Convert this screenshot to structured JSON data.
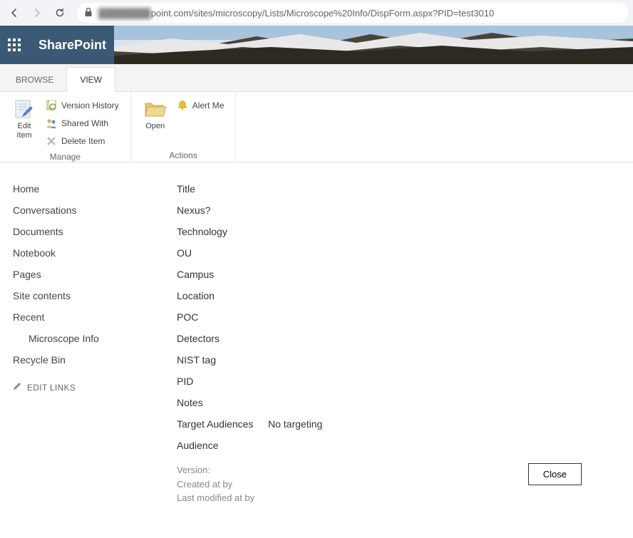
{
  "browser": {
    "url_prefix_blurred": "████████",
    "url_rest": "point.com/sites/microscopy/Lists/Microscope%20Info/DispForm.aspx?PID=test3010"
  },
  "header": {
    "app_title": "SharePoint"
  },
  "ribbon": {
    "tabs": {
      "browse": "BROWSE",
      "view": "VIEW"
    },
    "edit_item": "Edit\nItem",
    "version_history": "Version History",
    "shared_with": "Shared With",
    "delete_item": "Delete Item",
    "group_manage": "Manage",
    "open": "Open",
    "alert_me": "Alert Me",
    "group_actions": "Actions"
  },
  "leftnav": {
    "home": "Home",
    "conversations": "Conversations",
    "documents": "Documents",
    "notebook": "Notebook",
    "pages": "Pages",
    "site_contents": "Site contents",
    "recent": "Recent",
    "microscope_info": "Microscope Info",
    "recycle_bin": "Recycle Bin",
    "edit_links": "EDIT LINKS"
  },
  "fields": {
    "title": "Title",
    "nexus": "Nexus?",
    "technology": "Technology",
    "ou": "OU",
    "campus": "Campus",
    "location": "Location",
    "poc": "POC",
    "detectors": "Detectors",
    "nist_tag": "NIST tag",
    "pid": "PID",
    "notes": "Notes",
    "target_audiences": "Target Audiences",
    "target_audiences_value": "No targeting",
    "audience": "Audience"
  },
  "meta": {
    "version": "Version:",
    "created": "Created at by",
    "modified": "Last modified at by"
  },
  "buttons": {
    "close": "Close"
  }
}
